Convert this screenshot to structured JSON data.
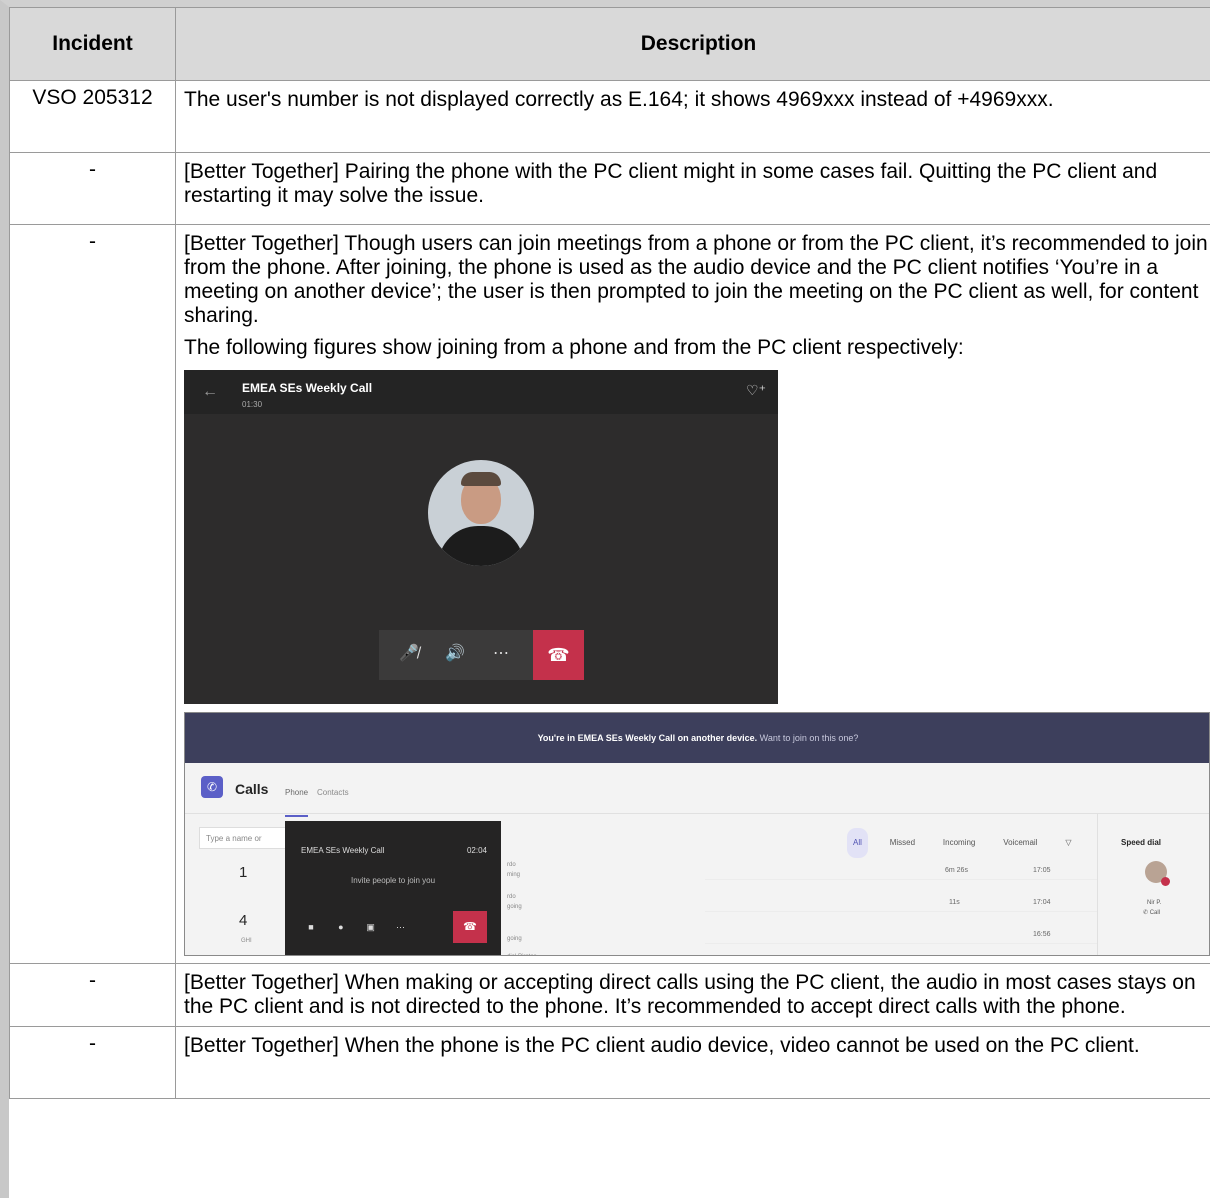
{
  "table": {
    "header_incident": "Incident",
    "header_description": "Description",
    "rows": [
      {
        "incident": "VSO 205312",
        "description": "The user's number is not displayed correctly as E.164; it shows 4969xxx instead of +4969xxx."
      },
      {
        "incident": "-",
        "description": "[Better Together] Pairing the phone with the PC client might in some cases fail. Quitting the PC client and restarting it may solve the issue."
      },
      {
        "incident": "-",
        "description": "[Better Together] Though users can join meetings from a phone or from the PC client, it’s recommended to join from the phone. After joining, the phone is used as the audio device and the PC client notifies ‘You’re in a meeting on another device’; the user is then prompted to join the meeting on the PC client as well, for content sharing.",
        "description2": "The following figures show joining from a phone and from the PC client respectively:"
      },
      {
        "incident": "-",
        "description": "[Better Together] When making or accepting direct calls using the PC client, the audio in most cases stays on the PC client and is not directed to the phone. It’s recommended to accept direct calls with the phone."
      },
      {
        "incident": "-",
        "description": "[Better Together] When the phone is the PC client audio device, video cannot be used on the PC client."
      }
    ]
  },
  "phone_screenshot": {
    "title": "EMEA SEs Weekly Call",
    "time": "01:30",
    "back_icon": "arrow-left-icon",
    "add_people_icon": "add-people-icon",
    "controls": [
      "mic-off-icon",
      "speaker-icon",
      "more-icon",
      "hang-up-icon"
    ]
  },
  "pc_screenshot": {
    "banner_bold": "You're in EMEA SEs Weekly Call on another device.",
    "banner_rest": "Want to join on this one?",
    "calls_label": "Calls",
    "tab_phone": "Phone",
    "tab_contacts": "Contacts",
    "search_placeholder": "Type a name or",
    "dial_1": "1",
    "dial_4": "4",
    "dial_4_sub": "GHI",
    "popup_title": "EMEA SEs Weekly Call",
    "popup_time": "02:04",
    "popup_invite": "Invite people to join you",
    "filters": [
      "All",
      "Missed",
      "Incoming",
      "Voicemail"
    ],
    "durations": [
      "6m 26s",
      "11s",
      ""
    ],
    "times": [
      "17:05",
      "17:04",
      "16:56"
    ],
    "speed_dial": "Speed dial",
    "speed_name": "Nir P.",
    "speed_call": "Call",
    "hist_labels": [
      "rdo",
      "ming",
      "rdo",
      "going",
      "going",
      "dial Pirates"
    ]
  }
}
